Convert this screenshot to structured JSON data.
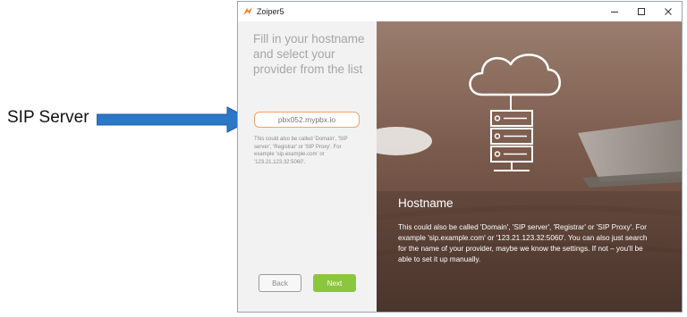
{
  "annotation": {
    "label": "SIP Server",
    "arrow_color": "#2b77c8"
  },
  "window": {
    "title": "Zoiper5",
    "icons": {
      "app": "zoiper-logo-icon",
      "minimize": "minimize-icon",
      "maximize": "maximize-icon",
      "close": "close-icon"
    }
  },
  "left": {
    "heading": "Fill in your hostname and select your provider from the list",
    "hostname_value": "pbx052.mypbx.io",
    "hint": "This could also be called 'Domain', 'SIP server', 'Registrar' or 'SIP Proxy'. For example 'sip.example.com' or '123.21.123.32:5060'.",
    "back_label": "Back",
    "next_label": "Next"
  },
  "right": {
    "title": "Hostname",
    "text": "This could also be called 'Domain', 'SIP server', 'Registrar' or 'SIP Proxy'. For example 'sip.example.com' or '123.21.123.32:5060'. You can also just search for the name of your provider, maybe we know the settings. If not – you'll be able to set it up manually.",
    "illustration": "cloud-server-illustration"
  },
  "colors": {
    "accent_green": "#8cc63f",
    "input_border": "#f0a36b",
    "left_panel_bg": "#f2f2f2",
    "right_panel_bg": "#7a5a4c"
  }
}
